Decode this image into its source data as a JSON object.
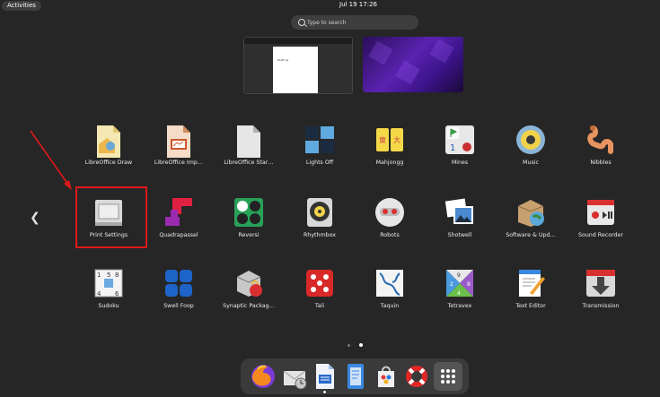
{
  "topbar": {
    "activities_label": "Activities",
    "clock": "Jul 19  17:26"
  },
  "search": {
    "placeholder": "Type to search"
  },
  "workspaces": {
    "doc_text": "Draft up"
  },
  "apps": [
    {
      "label": "LibreOffice Draw",
      "icon": "libreoffice-draw-icon"
    },
    {
      "label": "LibreOffice Imp…",
      "icon": "libreoffice-impress-icon"
    },
    {
      "label": "LibreOffice Star…",
      "icon": "libreoffice-start-icon"
    },
    {
      "label": "Lights Off",
      "icon": "lights-off-icon"
    },
    {
      "label": "Mahjongg",
      "icon": "mahjongg-icon"
    },
    {
      "label": "Mines",
      "icon": "mines-icon"
    },
    {
      "label": "Music",
      "icon": "music-icon"
    },
    {
      "label": "Nibbles",
      "icon": "nibbles-icon"
    },
    {
      "label": "Print Settings",
      "icon": "printer-icon"
    },
    {
      "label": "Quadrapassel",
      "icon": "quadrapassel-icon"
    },
    {
      "label": "Reversi",
      "icon": "reversi-icon"
    },
    {
      "label": "Rhythmbox",
      "icon": "rhythmbox-icon"
    },
    {
      "label": "Robots",
      "icon": "robots-icon"
    },
    {
      "label": "Shotwell",
      "icon": "shotwell-icon"
    },
    {
      "label": "Software & Upd…",
      "icon": "software-updates-icon"
    },
    {
      "label": "Sound Recorder",
      "icon": "sound-recorder-icon"
    },
    {
      "label": "Sudoku",
      "icon": "sudoku-icon"
    },
    {
      "label": "Swell Foop",
      "icon": "swell-foop-icon"
    },
    {
      "label": "Synaptic Packag…",
      "icon": "synaptic-icon"
    },
    {
      "label": "Tali",
      "icon": "tali-icon"
    },
    {
      "label": "Taquin",
      "icon": "taquin-icon"
    },
    {
      "label": "Tetravex",
      "icon": "tetravex-icon"
    },
    {
      "label": "Text Editor",
      "icon": "text-editor-icon"
    },
    {
      "label": "Transmission",
      "icon": "transmission-icon"
    }
  ],
  "dock": [
    "firefox-icon",
    "mail-icon",
    "writer-icon",
    "docs-icon",
    "software-store-icon",
    "help-icon",
    "app-grid-icon"
  ],
  "pager": {
    "page_count": 2,
    "current_page": 2
  },
  "colors": {
    "background": "#262626",
    "highlight": "#e01818",
    "dock": "#3a3a3a"
  }
}
